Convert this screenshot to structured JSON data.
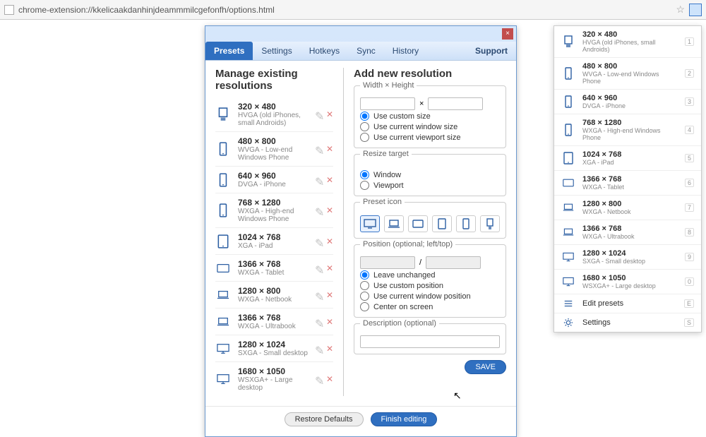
{
  "url": "chrome-extension://kkelicaakdanhinjdeammmilcgefonfh/options.html",
  "tabs": {
    "presets": "Presets",
    "settings": "Settings",
    "hotkeys": "Hotkeys",
    "sync": "Sync",
    "history": "History",
    "support": "Support"
  },
  "manage_title": "Manage existing resolutions",
  "add_title": "Add new resolution",
  "resolutions": [
    {
      "dim": "320 × 480",
      "desc": "HVGA (old iPhones, small Androids)",
      "icon": "phone-old"
    },
    {
      "dim": "480 × 800",
      "desc": "WVGA - Low-end Windows Phone",
      "icon": "phone"
    },
    {
      "dim": "640 × 960",
      "desc": "DVGA - iPhone",
      "icon": "phone"
    },
    {
      "dim": "768 × 1280",
      "desc": "WXGA - High-end Windows Phone",
      "icon": "phone"
    },
    {
      "dim": "1024 × 768",
      "desc": "XGA - iPad",
      "icon": "tablet"
    },
    {
      "dim": "1366 × 768",
      "desc": "WXGA - Tablet",
      "icon": "tablet-wide"
    },
    {
      "dim": "1280 × 800",
      "desc": "WXGA - Netbook",
      "icon": "laptop"
    },
    {
      "dim": "1366 × 768",
      "desc": "WXGA - Ultrabook",
      "icon": "laptop"
    },
    {
      "dim": "1280 × 1024",
      "desc": "SXGA - Small desktop",
      "icon": "desktop"
    },
    {
      "dim": "1680 × 1050",
      "desc": "WSXGA+ - Large desktop",
      "icon": "desktop"
    }
  ],
  "form": {
    "wh_legend": "Width × Height",
    "times": "×",
    "size": {
      "custom": "Use custom size",
      "window": "Use current window size",
      "viewport": "Use current viewport size"
    },
    "target_legend": "Resize target",
    "target": {
      "window": "Window",
      "viewport": "Viewport"
    },
    "icon_legend": "Preset icon",
    "pos_legend": "Position (optional; left/top)",
    "slash": "/",
    "pos": {
      "unchanged": "Leave unchanged",
      "custom": "Use custom position",
      "window": "Use current window position",
      "center": "Center on screen"
    },
    "desc_legend": "Description (optional)",
    "save": "SAVE"
  },
  "footer": {
    "restore": "Restore Defaults",
    "finish": "Finish editing"
  },
  "popup_actions": {
    "edit": "Edit presets",
    "settings": "Settings"
  },
  "popup_keys": [
    "1",
    "2",
    "3",
    "4",
    "5",
    "6",
    "7",
    "8",
    "9",
    "0",
    "E",
    "S"
  ]
}
